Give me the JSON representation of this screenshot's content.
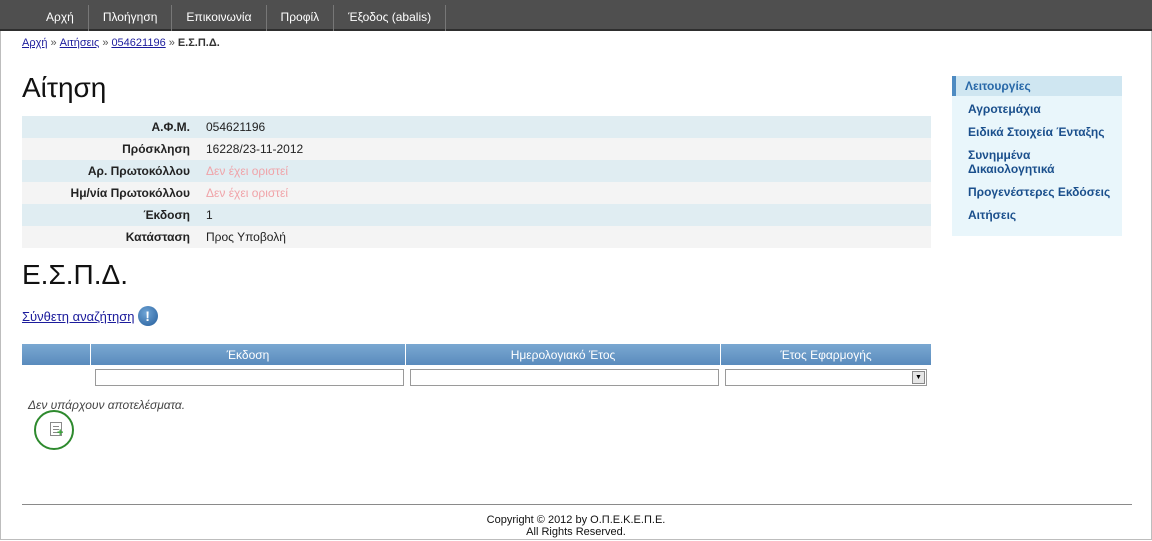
{
  "nav": {
    "items": [
      "Αρχή",
      "Πλοήγηση",
      "Επικοινωνία",
      "Προφίλ",
      "Έξοδος (abalis)"
    ]
  },
  "breadcrumb": {
    "home": "Αρχή",
    "applications": "Αιτήσεις",
    "afm": "054621196",
    "current": "Ε.Σ.Π.Δ.",
    "sep": "»"
  },
  "title": "Αίτηση",
  "info": {
    "rows": [
      {
        "label": "Α.Φ.Μ.",
        "value": "054621196"
      },
      {
        "label": "Πρόσκληση",
        "value": "16228/23-11-2012"
      },
      {
        "label": "Αρ. Πρωτοκόλλου",
        "value": "Δεν έχει οριστεί"
      },
      {
        "label": "Ημ/νία Πρωτοκόλλου",
        "value": "Δεν έχει οριστεί"
      },
      {
        "label": "Έκδοση",
        "value": "1"
      },
      {
        "label": "Κατάσταση",
        "value": "Προς Υποβολή"
      }
    ]
  },
  "section_title": "Ε.Σ.Π.Δ.",
  "advanced_search": "Σύνθετη αναζήτηση",
  "grid": {
    "columns": [
      "Έκδοση",
      "Ημερολογιακό Έτος",
      "Έτος Εφαρμογής"
    ],
    "empty": "Δεν υπάρχουν αποτελέσματα."
  },
  "sidebar": {
    "header": "Λειτουργίες",
    "items": [
      "Αγροτεμάχια",
      "Ειδικά Στοιχεία Ένταξης",
      "Συνημμένα Δικαιολογητικά",
      "Προγενέστερες Εκδόσεις",
      "Αιτήσεις"
    ]
  },
  "footer": {
    "line1": "Copyright © 2012 by Ο.Π.Ε.Κ.Ε.Π.Ε.",
    "line2": "All Rights Reserved."
  },
  "icons": {
    "info": "info-icon",
    "add": "add-record-icon",
    "dropdown": "dropdown-arrow-icon"
  },
  "colors": {
    "nav_bg": "#4f4f4f",
    "grid_header": "#6f9fcc",
    "row_alt": "#e0edf2",
    "muted_value": "#f0a3a8",
    "link": "#1c1c9c",
    "sidebar_bg": "#e9f6fb"
  }
}
